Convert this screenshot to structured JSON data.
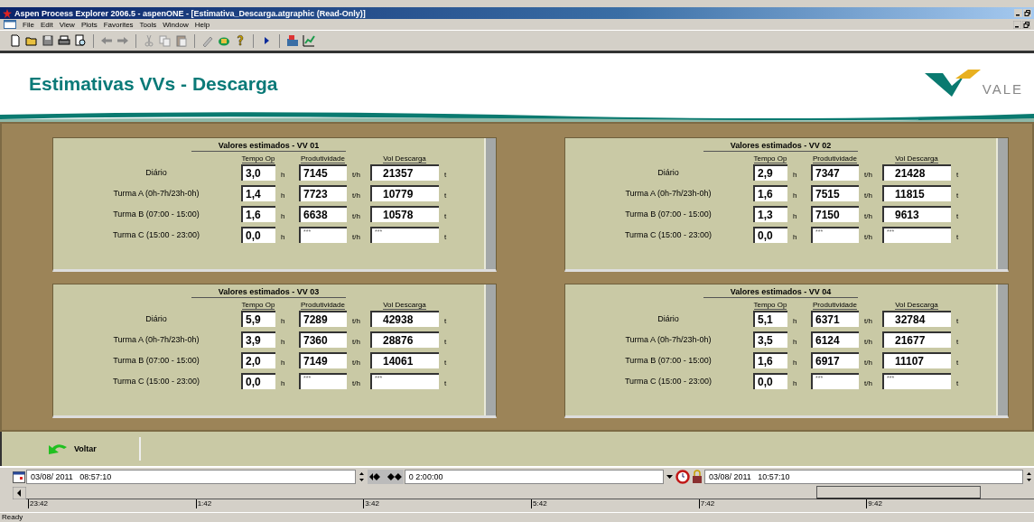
{
  "window": {
    "title": "Aspen Process Explorer 2006.5 - aspenONE - [Estimativa_Descarga.atgraphic (Read-Only)]"
  },
  "menu": [
    "File",
    "Edit",
    "View",
    "Plots",
    "Favorites",
    "Tools",
    "Window",
    "Help"
  ],
  "header": {
    "title": "Estimativas VVs - Descarga",
    "logo_text": "VALE"
  },
  "panels": [
    {
      "title": "Valores estimados - VV 01",
      "columns": [
        "Tempo Op",
        "Produtividade",
        "Vol Descarga"
      ],
      "rows": [
        {
          "label": "Diário",
          "tempo": "3,0",
          "tempo_unit": "h",
          "prod": {
            "value": "7145"
          },
          "prod_unit": "t/h",
          "vol": {
            "value": "21357"
          },
          "vol_unit": "t"
        },
        {
          "label": "Turma A (0h-7h/23h-0h)",
          "tempo": "1,4",
          "tempo_unit": "h",
          "prod": {
            "value": "7723"
          },
          "prod_unit": "t/h",
          "vol": {
            "value": "10779"
          },
          "vol_unit": "t"
        },
        {
          "label": "Turma B (07:00 - 15:00)",
          "tempo": "1,6",
          "tempo_unit": "h",
          "prod": {
            "value": "6638"
          },
          "prod_unit": "t/h",
          "vol": {
            "value": "10578"
          },
          "vol_unit": "t"
        },
        {
          "label": "Turma C (15:00 - 23:00)",
          "tempo": "0,0",
          "tempo_unit": "h",
          "prod": {
            "placeholder": "***"
          },
          "prod_unit": "t/h",
          "vol": {
            "placeholder": "***"
          },
          "vol_unit": "t"
        }
      ]
    },
    {
      "title": "Valores estimados - VV 02",
      "columns": [
        "Tempo Op",
        "Produtividade",
        "Vol Descarga"
      ],
      "rows": [
        {
          "label": "Diário",
          "tempo": "2,9",
          "tempo_unit": "h",
          "prod": {
            "value": "7347"
          },
          "prod_unit": "t/h",
          "vol": {
            "value": "21428"
          },
          "vol_unit": "t"
        },
        {
          "label": "Turma A (0h-7h/23h-0h)",
          "tempo": "1,6",
          "tempo_unit": "h",
          "prod": {
            "value": "7515"
          },
          "prod_unit": "t/h",
          "vol": {
            "value": "11815"
          },
          "vol_unit": "t"
        },
        {
          "label": "Turma B (07:00 - 15:00)",
          "tempo": "1,3",
          "tempo_unit": "h",
          "prod": {
            "value": "7150"
          },
          "prod_unit": "t/h",
          "vol": {
            "value": "9613"
          },
          "vol_unit": "t"
        },
        {
          "label": "Turma C (15:00 - 23:00)",
          "tempo": "0,0",
          "tempo_unit": "h",
          "prod": {
            "placeholder": "***"
          },
          "prod_unit": "t/h",
          "vol": {
            "placeholder": "***"
          },
          "vol_unit": "t"
        }
      ]
    },
    {
      "title": "Valores estimados - VV 03",
      "columns": [
        "Tempo Op",
        "Produtividade",
        "Vol Descarga"
      ],
      "rows": [
        {
          "label": "Diário",
          "tempo": "5,9",
          "tempo_unit": "h",
          "prod": {
            "value": "7289"
          },
          "prod_unit": "t/h",
          "vol": {
            "value": "42938"
          },
          "vol_unit": "t"
        },
        {
          "label": "Turma A (0h-7h/23h-0h)",
          "tempo": "3,9",
          "tempo_unit": "h",
          "prod": {
            "value": "7360"
          },
          "prod_unit": "t/h",
          "vol": {
            "value": "28876"
          },
          "vol_unit": "t"
        },
        {
          "label": "Turma B (07:00 - 15:00)",
          "tempo": "2,0",
          "tempo_unit": "h",
          "prod": {
            "value": "7149"
          },
          "prod_unit": "t/h",
          "vol": {
            "value": "14061"
          },
          "vol_unit": "t"
        },
        {
          "label": "Turma C (15:00 - 23:00)",
          "tempo": "0,0",
          "tempo_unit": "h",
          "prod": {
            "placeholder": "***"
          },
          "prod_unit": "t/h",
          "vol": {
            "placeholder": "***"
          },
          "vol_unit": "t"
        }
      ]
    },
    {
      "title": "Valores estimados - VV 04",
      "columns": [
        "Tempo Op",
        "Produtividade",
        "Vol Descarga"
      ],
      "rows": [
        {
          "label": "Diário",
          "tempo": "5,1",
          "tempo_unit": "h",
          "prod": {
            "value": "6371"
          },
          "prod_unit": "t/h",
          "vol": {
            "value": "32784"
          },
          "vol_unit": "t"
        },
        {
          "label": "Turma A (0h-7h/23h-0h)",
          "tempo": "3,5",
          "tempo_unit": "h",
          "prod": {
            "value": "6124"
          },
          "prod_unit": "t/h",
          "vol": {
            "value": "21677"
          },
          "vol_unit": "t"
        },
        {
          "label": "Turma B (07:00 - 15:00)",
          "tempo": "1,6",
          "tempo_unit": "h",
          "prod": {
            "value": "6917"
          },
          "prod_unit": "t/h",
          "vol": {
            "value": "11107"
          },
          "vol_unit": "t"
        },
        {
          "label": "Turma C (15:00 - 23:00)",
          "tempo": "0,0",
          "tempo_unit": "h",
          "prod": {
            "placeholder": "***"
          },
          "prod_unit": "t/h",
          "vol": {
            "placeholder": "***"
          },
          "vol_unit": "t"
        }
      ]
    }
  ],
  "back_button": {
    "label": "Voltar"
  },
  "time_bar": {
    "start": "03/08/ 2011   08:57:10",
    "span": "0 2:00:00",
    "end": "03/08/ 2011   10:57:10",
    "ticks": [
      "23:42",
      "1:42",
      "3:42",
      "5:42",
      "7:42",
      "9:42"
    ]
  },
  "status_bar": "Ready"
}
